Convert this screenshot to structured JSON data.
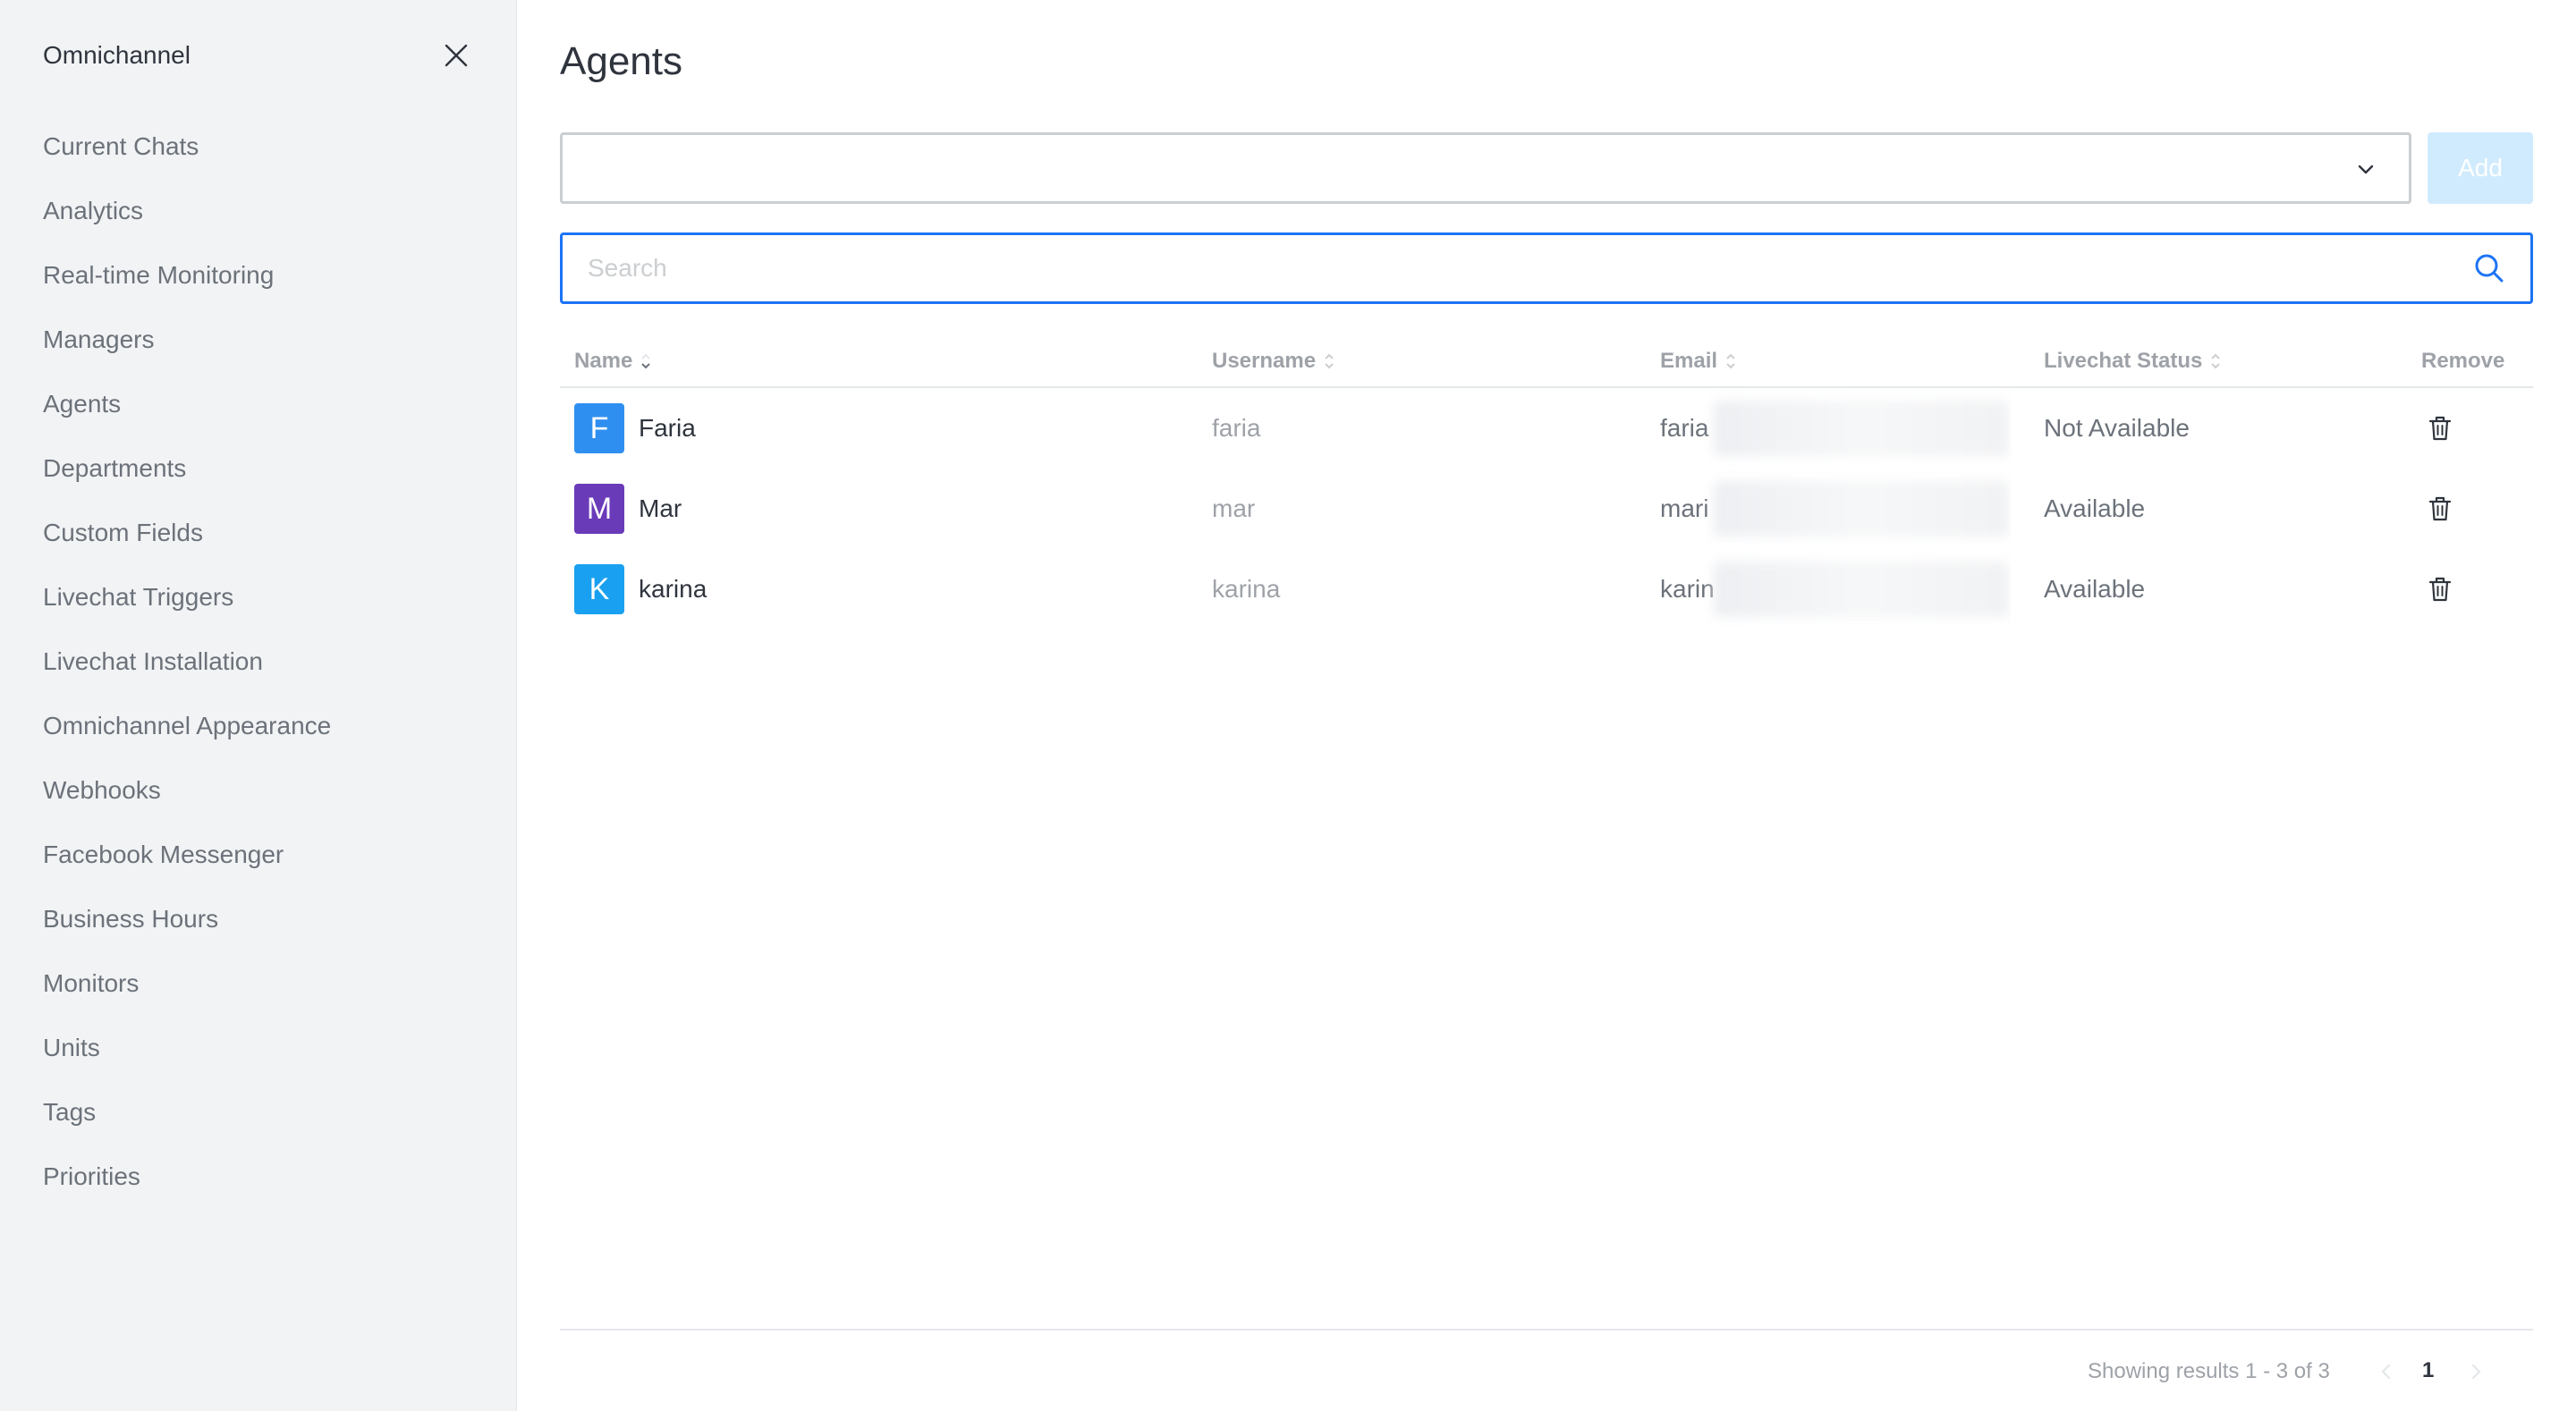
{
  "sidebar": {
    "title": "Omnichannel",
    "items": [
      {
        "label": "Current Chats"
      },
      {
        "label": "Analytics"
      },
      {
        "label": "Real-time Monitoring"
      },
      {
        "label": "Managers"
      },
      {
        "label": "Agents"
      },
      {
        "label": "Departments"
      },
      {
        "label": "Custom Fields"
      },
      {
        "label": "Livechat Triggers"
      },
      {
        "label": "Livechat Installation"
      },
      {
        "label": "Omnichannel Appearance"
      },
      {
        "label": "Webhooks"
      },
      {
        "label": "Facebook Messenger"
      },
      {
        "label": "Business Hours"
      },
      {
        "label": "Monitors"
      },
      {
        "label": "Units"
      },
      {
        "label": "Tags"
      },
      {
        "label": "Priorities"
      }
    ]
  },
  "main": {
    "title": "Agents",
    "agent_select": {
      "value": "",
      "icon": "chevron-down-icon"
    },
    "add_label": "Add",
    "search": {
      "placeholder": "Search",
      "value": "",
      "icon": "search-icon"
    },
    "table": {
      "headers": {
        "name": "Name",
        "username": "Username",
        "email": "Email",
        "status": "Livechat Status",
        "remove": "Remove"
      },
      "rows": [
        {
          "initial": "F",
          "avatar_color": "#2f8ff0",
          "name": "Faria",
          "username": "faria",
          "email_visible": "faria",
          "status": "Not Available"
        },
        {
          "initial": "M",
          "avatar_color": "#6a3bb8",
          "name": "Mar",
          "username": "mar",
          "email_visible": "mari",
          "status": "Available"
        },
        {
          "initial": "K",
          "avatar_color": "#1aa0f0",
          "name": "karina",
          "username": "karina",
          "email_visible": "karin",
          "status": "Available"
        }
      ]
    },
    "pagination": {
      "results_text": "Showing results 1 - 3 of 3",
      "current_page": "1"
    }
  },
  "colors": {
    "accent": "#1d74f5",
    "add_button_disabled": "#d1ebfe",
    "sidebar_bg": "#f2f3f5"
  }
}
